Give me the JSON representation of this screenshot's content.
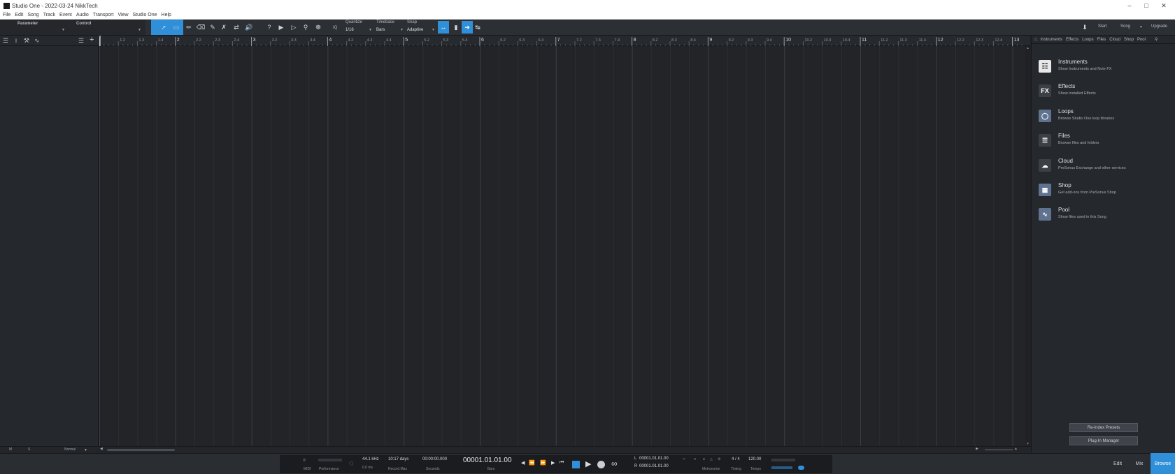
{
  "window": {
    "title": "Studio One - 2022-03-24 NikkTech",
    "controls": [
      "minimize-icon",
      "maximize-icon",
      "close-icon"
    ]
  },
  "menu": [
    "File",
    "Edit",
    "Song",
    "Track",
    "Event",
    "Audio",
    "Transport",
    "View",
    "Studio One",
    "Help"
  ],
  "toolbar": {
    "parameter_label": "Parameter",
    "control_label": "Control",
    "quantize": {
      "label": "Quantize",
      "value": "1/16"
    },
    "timebase": {
      "label": "Timebase",
      "value": "Bars"
    },
    "snap": {
      "label": "Snap",
      "value": "Adaptive"
    },
    "iq_label": "IQ",
    "start_label": "Start",
    "song_label": "Song",
    "upgrade_label": "Upgrade"
  },
  "ruler": {
    "labels": [
      "1.2",
      "1.3",
      "1.4",
      "2",
      "2.2",
      "2.3",
      "2.4",
      "3",
      "3.2",
      "3.3",
      "3.4",
      "4",
      "4.2",
      "4.3",
      "4.4",
      "5",
      "5.2",
      "5.3",
      "5.4",
      "6",
      "6.2",
      "6.3",
      "6.4",
      "7",
      "7.2",
      "7.3",
      "7.4",
      "8",
      "8.2",
      "8.3",
      "8.4",
      "9",
      "9.2",
      "9.3",
      "9.4",
      "10",
      "10.2",
      "10.3",
      "10.4",
      "11",
      "11.2",
      "11.3",
      "11.4",
      "12",
      "12.2",
      "12.3",
      "12.4",
      "13"
    ]
  },
  "browser": {
    "tabs": [
      "Instruments",
      "Effects",
      "Loops",
      "Files",
      "Cloud",
      "Shop",
      "Pool"
    ],
    "items": [
      {
        "title": "Instruments",
        "subtitle": "Show Instruments and Note FX",
        "icon": "piano-icon"
      },
      {
        "title": "Effects",
        "subtitle": "Show installed Effects",
        "icon": "fx-icon",
        "glyph": "FX"
      },
      {
        "title": "Loops",
        "subtitle": "Browse Studio One loop libraries",
        "icon": "loops-icon"
      },
      {
        "title": "Files",
        "subtitle": "Browse files and folders",
        "icon": "files-icon"
      },
      {
        "title": "Cloud",
        "subtitle": "PreSonus Exchange and other services",
        "icon": "cloud-icon"
      },
      {
        "title": "Shop",
        "subtitle": "Get add-ons from PreSonus Shop",
        "icon": "shop-icon"
      },
      {
        "title": "Pool",
        "subtitle": "Show files used in this Song",
        "icon": "pool-icon"
      }
    ],
    "reindex_label": "Re-Index Presets",
    "plugin_manager_label": "Plug-In Manager"
  },
  "bottom_strip": {
    "m": "M",
    "s": "S",
    "mode": "Normal"
  },
  "transport": {
    "midi_label": "MIDI",
    "performance_label": "Performance",
    "sample_rate": "44.1 kHz",
    "latency": "0.0 ms",
    "record_time": "10:17 days",
    "record_max_label": "Record Max",
    "seconds_value": "00:00:00.000",
    "seconds_label": "Seconds",
    "bars_value": "00001.01.01.00",
    "bars_label": "Bars",
    "loop_l": "00001.01.01.00",
    "loop_r": "00001.01.01.00",
    "metronome_label": "Metronome",
    "timing_value": "4 / 4",
    "timing_label": "Timing",
    "tempo_value": "120.00",
    "tempo_label": "Tempo"
  },
  "views": {
    "edit": "Edit",
    "mix": "Mix",
    "browse": "Browse"
  },
  "colors": {
    "accent": "#2f8fd8",
    "background": "#222428"
  }
}
